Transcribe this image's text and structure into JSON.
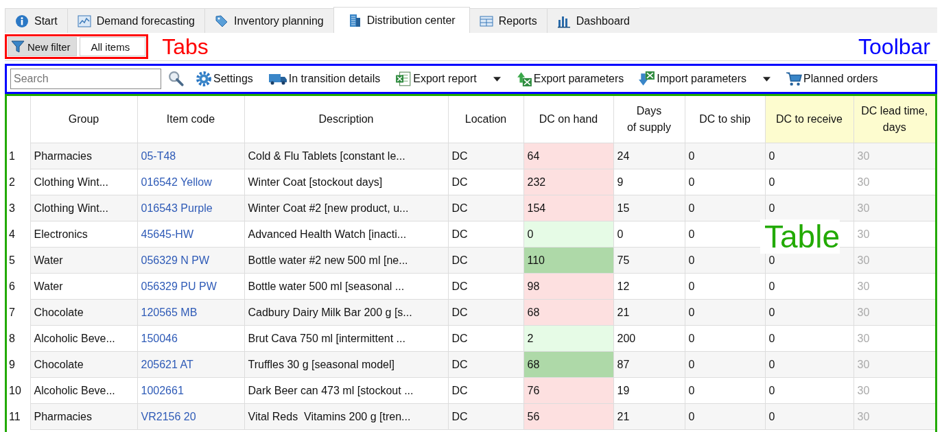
{
  "tabs": [
    {
      "label": "Start",
      "selected": false
    },
    {
      "label": "Demand forecasting",
      "selected": false
    },
    {
      "label": "Inventory planning",
      "selected": false
    },
    {
      "label": "Distribution center",
      "selected": true
    },
    {
      "label": "Reports",
      "selected": false
    },
    {
      "label": "Dashboard",
      "selected": false
    }
  ],
  "filter_tabs": [
    {
      "label": "New filter",
      "selected": true
    },
    {
      "label": "All items",
      "selected": false
    }
  ],
  "annotations": [
    {
      "label": "Tabs",
      "color": "#ff0000"
    },
    {
      "label": "Toolbar",
      "color": "#0000ff"
    },
    {
      "label": "Table",
      "color": "#22aa00"
    }
  ],
  "toolbar": {
    "search": {
      "placeholder": "Search"
    },
    "items": [
      {
        "label": "Settings",
        "dropdown": false
      },
      {
        "label": "In transition details",
        "dropdown": false
      },
      {
        "label": "Export report",
        "dropdown": true
      },
      {
        "label": "Export parameters",
        "dropdown": false
      },
      {
        "label": "Import parameters",
        "dropdown": true
      },
      {
        "label": "Planned orders",
        "dropdown": false
      }
    ]
  },
  "table": {
    "columns": [
      {
        "label": "Group",
        "highlighted": false
      },
      {
        "label": "Item code",
        "highlighted": false
      },
      {
        "label": "Description",
        "highlighted": false
      },
      {
        "label": "Location",
        "highlighted": false
      },
      {
        "label": "DC on hand",
        "highlighted": false
      },
      {
        "label": "Days\nof supply",
        "highlighted": false
      },
      {
        "label": "DC to ship",
        "highlighted": false
      },
      {
        "label": "DC to receive",
        "highlighted": true
      },
      {
        "label": "DC lead time,\ndays",
        "highlighted": true
      }
    ],
    "rows": [
      {
        "number": "1",
        "group": "Pharmacies",
        "item_code": "05-T48",
        "description": "Cold & Flu Tablets [constant le...",
        "location": "DC",
        "on_hand": "64",
        "color": "#fde0e0",
        "days_of_supply": "24",
        "to_ship": "0",
        "to_receive": "0",
        "lead_time": "30",
        "lead_time_disabled": true
      },
      {
        "number": "2",
        "group": "Clothing Wint...",
        "item_code": "016542 Yellow",
        "description": "Winter Coat [stockout days]",
        "location": "DC",
        "on_hand": "232",
        "color": "#fde0e0",
        "days_of_supply": "9",
        "to_ship": "0",
        "to_receive": "0",
        "lead_time": "30",
        "lead_time_disabled": true
      },
      {
        "number": "3",
        "group": "Clothing Wint...",
        "item_code": "016543 Purple",
        "description": "Winter Coat #2 [new product, u...",
        "location": "DC",
        "on_hand": "154",
        "color": "#fde0e0",
        "days_of_supply": "15",
        "to_ship": "0",
        "to_receive": "0",
        "lead_time": "30",
        "lead_time_disabled": true
      },
      {
        "number": "4",
        "group": "Electronics",
        "item_code": "45645-HW",
        "description": "Advanced Health Watch [inacti...",
        "location": "DC",
        "on_hand": "0",
        "color": "#e6fbe6",
        "days_of_supply": "0",
        "to_ship": "0",
        "lead_time": "30",
        "lead_time_disabled": true
      },
      {
        "number": "5",
        "group": "Water",
        "item_code": "056329 N PW",
        "description": "Bottle water #2 new 500 ml [ne...",
        "location": "DC",
        "on_hand": "110",
        "color": "#aed9a8",
        "days_of_supply": "75",
        "to_ship": "0",
        "to_receive": "0",
        "lead_time": "30",
        "lead_time_disabled": true
      },
      {
        "number": "6",
        "group": "Water",
        "item_code": "056329 PU PW",
        "description": "Bottle water 500 ml [seasonal ...",
        "location": "DC",
        "on_hand": "98",
        "color": "#fde0e0",
        "days_of_supply": "12",
        "to_ship": "0",
        "to_receive": "0",
        "lead_time": "30",
        "lead_time_disabled": true
      },
      {
        "number": "7",
        "group": "Chocolate",
        "item_code": "120565 MB",
        "description": "Cadbury Dairy Milk Bar 200 g [s...",
        "location": "DC",
        "on_hand": "68",
        "color": "#fde0e0",
        "days_of_supply": "21",
        "to_ship": "0",
        "to_receive": "0",
        "lead_time": "30",
        "lead_time_disabled": true
      },
      {
        "number": "8",
        "group": "Alcoholic Beve...",
        "item_code": "150046",
        "description": "Brut Cava 750 ml [intermittent ...",
        "location": "DC",
        "on_hand": "2",
        "color": "#e6fbe6",
        "days_of_supply": "200",
        "to_ship": "0",
        "to_receive": "0",
        "lead_time": "30",
        "lead_time_disabled": true
      },
      {
        "number": "9",
        "group": "Chocolate",
        "item_code": "205621 AT",
        "description": "Truffles 30 g [seasonal model]",
        "location": "DC",
        "on_hand": "68",
        "color": "#aed9a8",
        "days_of_supply": "87",
        "to_ship": "0",
        "to_receive": "0",
        "lead_time": "30",
        "lead_time_disabled": true
      },
      {
        "number": "10",
        "group": "Alcoholic Beve...",
        "item_code": "1002661",
        "description": "Dark Beer can 473 ml [stockout ...",
        "location": "DC",
        "on_hand": "76",
        "color": "#fde0e0",
        "days_of_supply": "19",
        "to_ship": "0",
        "to_receive": "0",
        "lead_time": "30",
        "lead_time_disabled": true
      },
      {
        "number": "11",
        "group": "Pharmacies",
        "item_code": "VR2156 20",
        "description": "Vital Reds  Vitamins 200 g [tren...",
        "location": "DC",
        "on_hand": "56",
        "color": "#fde0e0",
        "days_of_supply": "21",
        "to_ship": "0",
        "to_receive": "0",
        "lead_time": "30",
        "lead_time_disabled": true
      }
    ]
  }
}
